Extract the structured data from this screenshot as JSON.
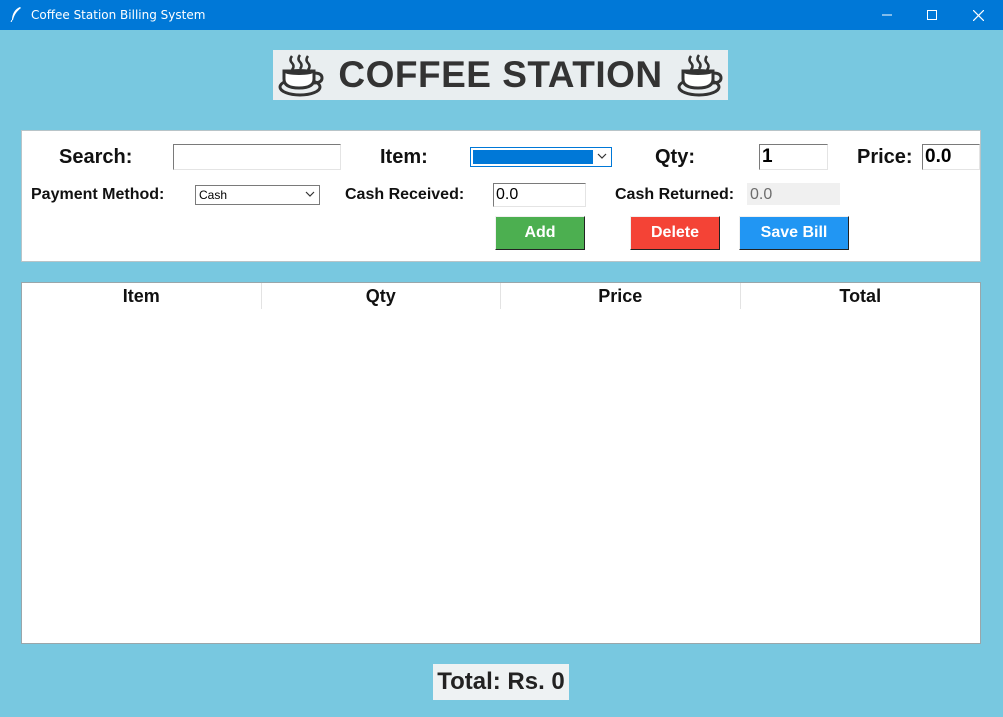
{
  "window": {
    "title": "Coffee Station Billing System"
  },
  "header": {
    "title": "COFFEE STATION",
    "icon": "coffee-cup-icon"
  },
  "form": {
    "search": {
      "label": "Search:",
      "value": ""
    },
    "item": {
      "label": "Item:",
      "value": ""
    },
    "qty": {
      "label": "Qty:",
      "value": "1"
    },
    "price": {
      "label": "Price:",
      "value": "0.0"
    },
    "payment": {
      "label": "Payment Method:",
      "value": "Cash"
    },
    "cash_received": {
      "label": "Cash Received:",
      "value": "0.0"
    },
    "cash_returned": {
      "label": "Cash Returned:",
      "value": "0.0"
    }
  },
  "buttons": {
    "add": {
      "label": "Add",
      "color": "#4caf50"
    },
    "delete": {
      "label": "Delete",
      "color": "#f44336"
    },
    "save": {
      "label": "Save Bill",
      "color": "#2196f3"
    }
  },
  "table": {
    "columns": [
      "Item",
      "Qty",
      "Price",
      "Total"
    ],
    "rows": []
  },
  "footer": {
    "total_text": "Total: Rs. 0"
  },
  "colors": {
    "background": "#78c8e0",
    "titlebar": "#0078d7"
  }
}
